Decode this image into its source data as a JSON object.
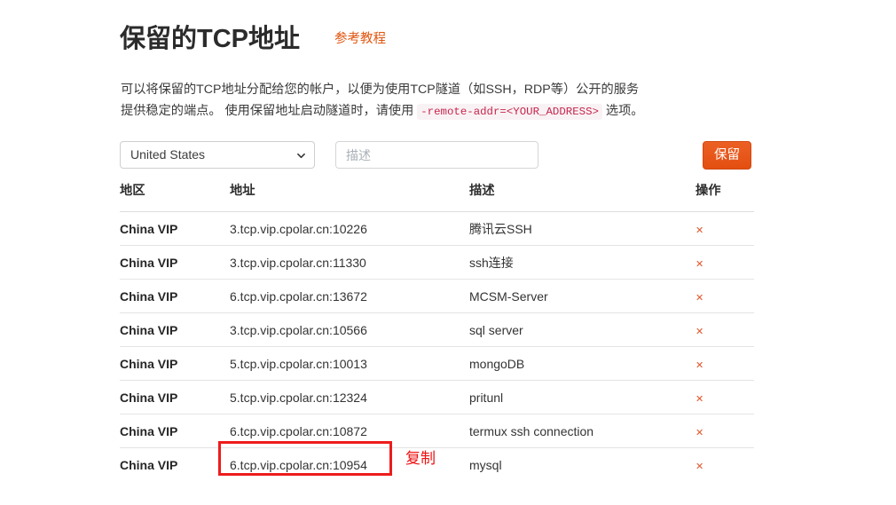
{
  "header": {
    "title": "保留的TCP地址",
    "tutorial_link": "参考教程"
  },
  "description": {
    "part1": "可以将保留的TCP地址分配给您的帐户，以便为使用TCP隧道（如SSH，RDP等）公开的服务提供稳定的端点。 使用保留地址启动隧道时，请使用 ",
    "code": "-remote-addr=<YOUR_ADDRESS>",
    "part2": " 选项。"
  },
  "form": {
    "region_selected": "United States",
    "region_options": [
      "United States",
      "China VIP"
    ],
    "description_placeholder": "描述",
    "description_value": "",
    "reserve_button": "保留"
  },
  "table": {
    "headers": {
      "region": "地区",
      "address": "地址",
      "description": "描述",
      "action": "操作"
    },
    "delete_icon": "✕",
    "rows": [
      {
        "region": "China VIP",
        "address": "3.tcp.vip.cpolar.cn:10226",
        "description": "腾讯云SSH"
      },
      {
        "region": "China VIP",
        "address": "3.tcp.vip.cpolar.cn:11330",
        "description": "ssh连接"
      },
      {
        "region": "China VIP",
        "address": "6.tcp.vip.cpolar.cn:13672",
        "description": "MCSM-Server"
      },
      {
        "region": "China VIP",
        "address": "3.tcp.vip.cpolar.cn:10566",
        "description": "sql server"
      },
      {
        "region": "China VIP",
        "address": "5.tcp.vip.cpolar.cn:10013",
        "description": "mongoDB"
      },
      {
        "region": "China VIP",
        "address": "5.tcp.vip.cpolar.cn:12324",
        "description": "pritunl"
      },
      {
        "region": "China VIP",
        "address": "6.tcp.vip.cpolar.cn:10872",
        "description": "termux ssh connection"
      },
      {
        "region": "China VIP",
        "address": "6.tcp.vip.cpolar.cn:10954",
        "description": "mysql"
      }
    ]
  },
  "annotations": {
    "copy_label": "复制",
    "highlight_color": "#ee1c1c"
  },
  "colors": {
    "accent_orange": "#e34f10",
    "link_orange": "#e0550f",
    "code_pink": "#c7254e",
    "annotation_red": "#ee1111"
  }
}
